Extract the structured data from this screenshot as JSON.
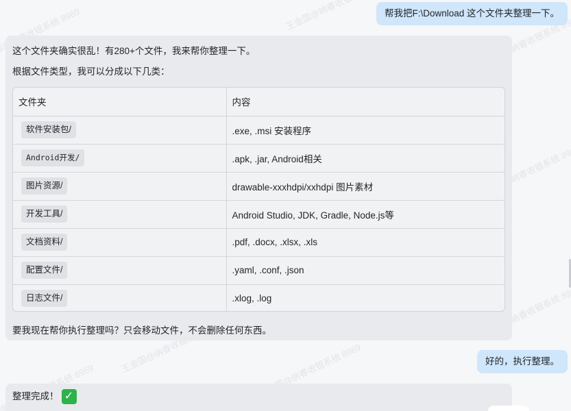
{
  "messages": {
    "user_1": "帮我把F:\\Download 这个文件夹整理一下。",
    "bot_1": {
      "intro": "这个文件夹确实很乱！有280+个文件，我来帮你整理一下。",
      "lead": "根据文件类型，我可以分成以下几类：",
      "table": {
        "headers": [
          "文件夹",
          "内容"
        ],
        "rows": [
          {
            "folder": "软件安装包/",
            "content": ".exe, .msi 安装程序"
          },
          {
            "folder": "Android开发/",
            "content": ".apk, .jar, Android相关"
          },
          {
            "folder": "图片资源/",
            "content": "drawable-xxxhdpi/xxhdpi 图片素材"
          },
          {
            "folder": "开发工具/",
            "content": "Android Studio, JDK, Gradle, Node.js等"
          },
          {
            "folder": "文档资料/",
            "content": ".pdf, .docx, .xlsx, .xls"
          },
          {
            "folder": "配置文件/",
            "content": ".yaml, .conf, .json"
          },
          {
            "folder": "日志文件/",
            "content": ".xlog, .log"
          }
        ]
      },
      "question": "要我现在帮你执行整理吗？只会移动文件，不会删除任何东西。"
    },
    "user_2": "好的，执行整理。",
    "bot_2": {
      "text": "整理完成！",
      "icon": "check-mark-icon"
    }
  },
  "watermark": "王金国@纳睿收银系统 8969",
  "colors": {
    "user_bubble": "#cfe6fb",
    "bot_bubble": "#e8eaed",
    "check": "#2eb24a"
  }
}
